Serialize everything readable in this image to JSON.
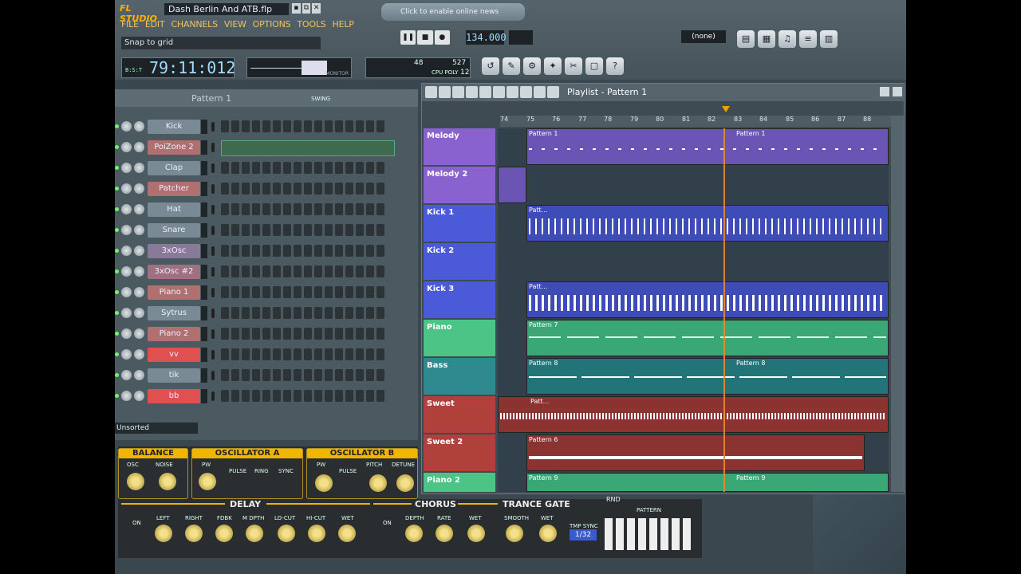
{
  "window": {
    "logo": "FL STUDIO",
    "filename": "Dash Berlin And ATB.flp",
    "win_buttons": [
      "▪",
      "⧉",
      "✕"
    ]
  },
  "menu": [
    "FILE",
    "EDIT",
    "CHANNELS",
    "VIEW",
    "OPTIONS",
    "TOOLS",
    "HELP"
  ],
  "hint": "Snap to grid",
  "news": "Click to enable online news",
  "time": {
    "value": "79:11:012",
    "labels": "B:S:T"
  },
  "monitor_label": "MONITOR",
  "cpu": {
    "left": "48",
    "right": "527",
    "polyphony": "12",
    "labels": "CPU POLY"
  },
  "tempo": "134.000",
  "snap": "(none)",
  "sequencer": {
    "pattern": "Pattern 1",
    "swing": "SWING",
    "bank": "Unsorted",
    "channels": [
      {
        "name": "Kick",
        "color": "#7a8a94"
      },
      {
        "name": "PoiZone 2",
        "color": "#b07070"
      },
      {
        "name": "Clap",
        "color": "#7a8a94"
      },
      {
        "name": "Patcher",
        "color": "#b07070"
      },
      {
        "name": "Hat",
        "color": "#7a8a94"
      },
      {
        "name": "Snare",
        "color": "#7a8a94"
      },
      {
        "name": "3xOsc",
        "color": "#8a7a9a"
      },
      {
        "name": "3xOsc #2",
        "color": "#a07080"
      },
      {
        "name": "Piano 1",
        "color": "#b07070"
      },
      {
        "name": "Sytrus",
        "color": "#7a8a94"
      },
      {
        "name": "Piano 2",
        "color": "#b07070"
      },
      {
        "name": "vv",
        "color": "#e05050"
      },
      {
        "name": "tik",
        "color": "#7a8a94"
      },
      {
        "name": "bb",
        "color": "#e05050"
      }
    ]
  },
  "synth": {
    "balance": {
      "title": "BALANCE",
      "osc": "OSC",
      "noise": "NOISE"
    },
    "osc_a": {
      "title": "OSCILLATOR A",
      "pw": "PW",
      "pulse": "PULSE",
      "ring": "RING",
      "sync": "SYNC"
    },
    "osc_b": {
      "title": "OSCILLATOR B",
      "pw": "PW",
      "pulse": "PULSE",
      "pitch": "PITCH",
      "detune": "DETUNE"
    }
  },
  "fx": {
    "delay": {
      "title": "DELAY",
      "on": "ON",
      "left": "LEFT",
      "right": "RIGHT",
      "fdbk": "FDBK",
      "mdepth": "M DPTH",
      "locut": "LO-CUT",
      "hicut": "HI-CUT",
      "wet": "WET"
    },
    "chorus": {
      "title": "CHORUS",
      "on": "ON",
      "depth": "DEPTH",
      "rate": "RATE",
      "wet": "WET"
    },
    "gate": {
      "title": "TRANCE GATE",
      "smooth": "SMOOTH",
      "wet": "WET",
      "tmp_sync": "TMP SYNC",
      "sync_val": "1/32",
      "rnd": "RND",
      "pattern": "PATTERN"
    }
  },
  "playlist": {
    "title": "Playlist - Pattern 1",
    "ruler": [
      "74",
      "75",
      "76",
      "77",
      "78",
      "79",
      "80",
      "81",
      "82",
      "83",
      "84",
      "85",
      "86",
      "87",
      "88"
    ],
    "tracks": [
      {
        "name": "Melody",
        "color": "#8a62d0"
      },
      {
        "name": "Melody 2",
        "color": "#8a62d0"
      },
      {
        "name": "Kick 1",
        "color": "#4a5ad8"
      },
      {
        "name": "Kick 2",
        "color": "#4a5ad8"
      },
      {
        "name": "Kick 3",
        "color": "#4a5ad8"
      },
      {
        "name": "Piano",
        "color": "#4cc486"
      },
      {
        "name": "Bass",
        "color": "#2e8a8e"
      },
      {
        "name": "Sweet",
        "color": "#b0403a"
      },
      {
        "name": "Sweet 2",
        "color": "#b0403a"
      },
      {
        "name": "Piano 2",
        "color": "#4cc486"
      }
    ],
    "clips": [
      {
        "label": "Pattern 1",
        "label2": "Pattern 1"
      },
      {
        "label": "",
        "label2": ""
      },
      {
        "label": "Patt...",
        "label2": ""
      },
      {
        "label": "",
        "label2": ""
      },
      {
        "label": "Patt...",
        "label2": ""
      },
      {
        "label": "Pattern 7",
        "label2": ""
      },
      {
        "label": "Pattern 8",
        "label2": "Pattern 8"
      },
      {
        "label": "Patt...",
        "label2": ""
      },
      {
        "label": "Pattern 6",
        "label2": ""
      },
      {
        "label": "Pattern 9",
        "label2": "Pattern 9"
      }
    ]
  }
}
